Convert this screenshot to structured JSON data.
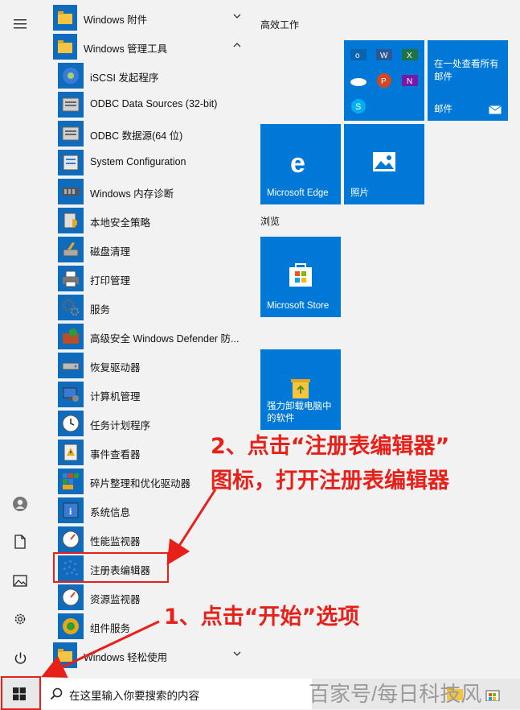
{
  "start_list": {
    "items": [
      {
        "label": "Windows 附件",
        "kind": "folder",
        "chevron": "down",
        "icon": "folder-icon"
      },
      {
        "label": "Windows 管理工具",
        "kind": "folder",
        "chevron": "up",
        "icon": "folder-icon"
      },
      {
        "label": "iSCSI 发起程序",
        "kind": "app",
        "icon": "iscsi-icon"
      },
      {
        "label": "ODBC Data Sources (32-bit)",
        "kind": "app",
        "icon": "odbc-icon"
      },
      {
        "label": "ODBC 数据源(64 位)",
        "kind": "app",
        "icon": "odbc-icon"
      },
      {
        "label": "System Configuration",
        "kind": "app",
        "icon": "system-config-icon"
      },
      {
        "label": "Windows 内存诊断",
        "kind": "app",
        "icon": "memory-chip-icon"
      },
      {
        "label": "本地安全策略",
        "kind": "app",
        "icon": "security-policy-icon"
      },
      {
        "label": "磁盘清理",
        "kind": "app",
        "icon": "disk-cleanup-icon"
      },
      {
        "label": "打印管理",
        "kind": "app",
        "icon": "printer-icon"
      },
      {
        "label": "服务",
        "kind": "app",
        "icon": "gears-icon"
      },
      {
        "label": "高级安全 Windows Defender 防...",
        "kind": "app",
        "icon": "firewall-icon"
      },
      {
        "label": "恢复驱动器",
        "kind": "app",
        "icon": "drive-icon"
      },
      {
        "label": "计算机管理",
        "kind": "app",
        "icon": "computer-management-icon"
      },
      {
        "label": "任务计划程序",
        "kind": "app",
        "icon": "clock-icon"
      },
      {
        "label": "事件查看器",
        "kind": "app",
        "icon": "event-viewer-icon"
      },
      {
        "label": "碎片整理和优化驱动器",
        "kind": "app",
        "icon": "defrag-icon"
      },
      {
        "label": "系统信息",
        "kind": "app",
        "icon": "info-icon"
      },
      {
        "label": "性能监视器",
        "kind": "app",
        "icon": "gauge-icon"
      },
      {
        "label": "注册表编辑器",
        "kind": "app",
        "icon": "registry-icon",
        "highlighted": true
      },
      {
        "label": "资源监视器",
        "kind": "app",
        "icon": "gauge-icon"
      },
      {
        "label": "组件服务",
        "kind": "app",
        "icon": "component-services-icon"
      },
      {
        "label": "Windows 轻松使用",
        "kind": "folder",
        "chevron": "down",
        "icon": "folder-icon"
      }
    ]
  },
  "tiles": {
    "group_productivity": "高效工作",
    "group_browse": "浏览",
    "mail_tile_text": "在一处查看所有邮件",
    "mail_tile_label": "邮件",
    "edge_label": "Microsoft Edge",
    "photos_label": "照片",
    "store_label": "Microsoft Store",
    "uninstall_label": "强力卸载电脑中的软件"
  },
  "taskbar": {
    "search_placeholder": "在这里输入你要搜索的内容"
  },
  "watermark": "百家号/每日科技风",
  "annotations": {
    "step2_line1": "2、点击“注册表编辑器”",
    "step2_line2": "图标，打开注册表编辑器",
    "step1": "1、点击“开始”选项"
  },
  "colors": {
    "accent": "#0078d7",
    "annotation": "#e8201a"
  }
}
